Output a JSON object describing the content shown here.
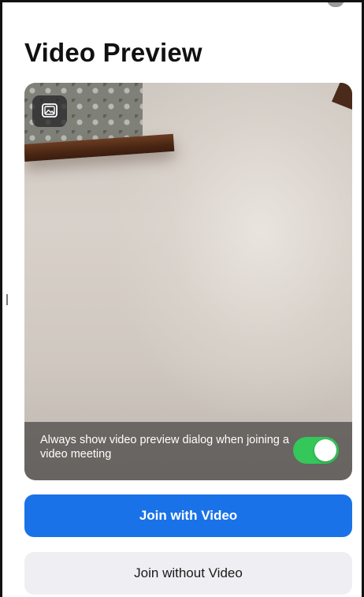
{
  "header": {
    "title": "Video Preview"
  },
  "preview": {
    "background_button_icon": "image-icon",
    "caption": "Always show video preview dialog when joining a video meeting",
    "toggle_on": true
  },
  "actions": {
    "join_with_video_label": "Join with Video",
    "join_without_video_label": "Join without Video"
  },
  "colors": {
    "primary": "#1a72e8",
    "toggle_on": "#34c759",
    "secondary_button": "#efeff3"
  }
}
